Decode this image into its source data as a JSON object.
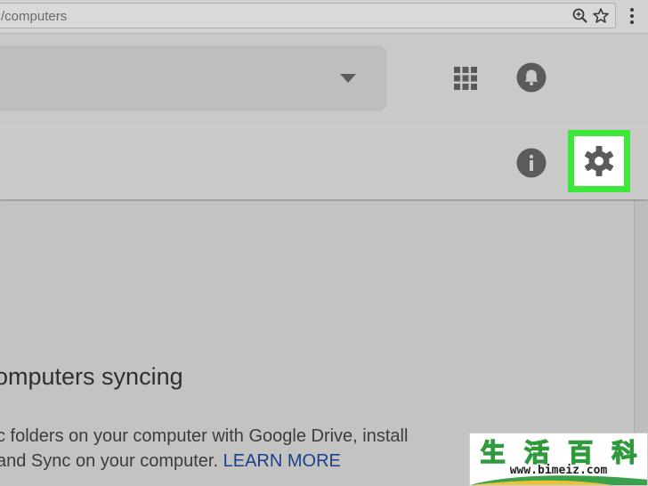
{
  "browser": {
    "url": "/computers",
    "icons": [
      "zoom-icon",
      "star-icon",
      "kebab-menu-icon"
    ]
  },
  "header": {
    "icons": [
      "chevron-down-icon",
      "apps-grid-icon",
      "notifications-bell-icon"
    ]
  },
  "toolbar": {
    "icons": [
      "info-icon",
      "gear-icon"
    ],
    "highlight_color": "#3ee83a"
  },
  "content": {
    "title": "omputers syncing",
    "line1": "c folders on your computer with Google Drive, install",
    "line2": "and Sync on your computer.",
    "learn_more": "LEARN MORE",
    "link_color": "#1d3f8c"
  },
  "watermark": {
    "chars": [
      "生",
      "活",
      "百",
      "科"
    ],
    "url": "www.bimeiz.com",
    "color": "#2e9a3c"
  }
}
